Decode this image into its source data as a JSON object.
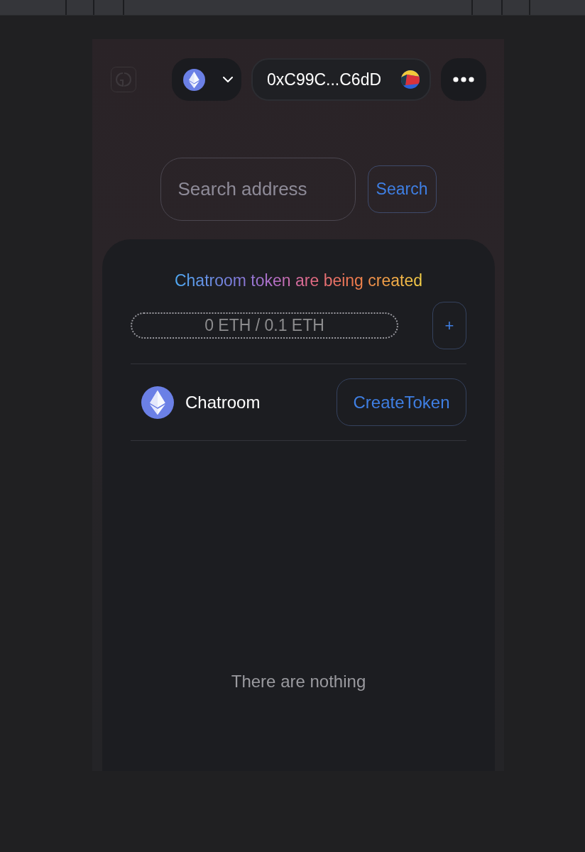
{
  "header": {
    "address": "0xC99C...C6dD"
  },
  "search": {
    "placeholder": "Search address",
    "button": "Search"
  },
  "panel": {
    "title": "Chatroom token are being created",
    "funding": "0 ETH / 0.1 ETH",
    "add_button": "+",
    "tokens": [
      {
        "name": "Chatroom",
        "action": "CreateToken"
      }
    ],
    "empty_message": "There are nothing"
  }
}
